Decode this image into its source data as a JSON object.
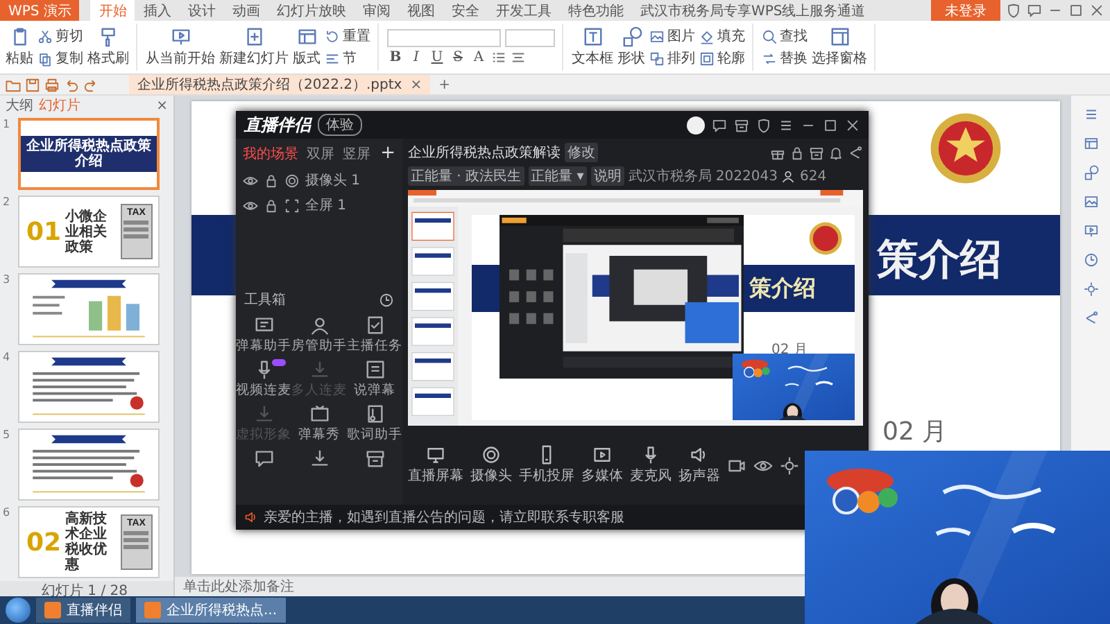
{
  "app_menu": {
    "label": "WPS 演示"
  },
  "tabs": [
    {
      "label": "开始",
      "selected": true
    },
    {
      "label": "插入",
      "selected": false
    },
    {
      "label": "设计",
      "selected": false
    },
    {
      "label": "动画",
      "selected": false
    },
    {
      "label": "幻灯片放映",
      "selected": false
    },
    {
      "label": "审阅",
      "selected": false
    },
    {
      "label": "视图",
      "selected": false
    },
    {
      "label": "安全",
      "selected": false
    },
    {
      "label": "开发工具",
      "selected": false
    },
    {
      "label": "特色功能",
      "selected": false
    },
    {
      "label": "武汉市税务局专享WPS线上服务通道",
      "selected": false
    }
  ],
  "login_button": "未登录",
  "ribbon": {
    "groups_left": [
      [
        [
          {
            "label": "粘贴",
            "kind": "paste"
          }
        ],
        [
          {
            "label": "剪切",
            "kind": "cut"
          },
          {
            "label": "复制",
            "kind": "copy"
          }
        ],
        [
          {
            "label": "格式刷",
            "kind": "brush"
          }
        ]
      ],
      [
        [
          {
            "label": "从当前开始",
            "kind": "play"
          }
        ],
        [
          {
            "label": "新建幻灯片",
            "kind": "newslide"
          }
        ],
        [
          {
            "label": "版式",
            "kind": "layout"
          }
        ],
        [
          {
            "label": "重置",
            "kind": "reset"
          },
          {
            "label": "节",
            "kind": "section"
          }
        ]
      ]
    ],
    "format_buttons": [
      "B",
      "I",
      "U",
      "S",
      "A"
    ],
    "groups_right": [
      [
        [
          {
            "label": "文本框",
            "kind": "textbox"
          }
        ],
        [
          {
            "label": "形状",
            "kind": "shape"
          }
        ],
        [
          {
            "label": "图片",
            "kind": "picture"
          },
          {
            "label": "排列",
            "kind": "arrange"
          }
        ],
        [
          {
            "label": "填充",
            "kind": "fill"
          },
          {
            "label": "轮廓",
            "kind": "outline"
          }
        ]
      ],
      [
        [
          {
            "label": "查找",
            "kind": "find"
          },
          {
            "label": "替换",
            "kind": "replace"
          }
        ],
        [
          {
            "label": "选择窗格",
            "kind": "pane"
          }
        ]
      ]
    ]
  },
  "document_tab": {
    "title": "企业所得税热点政策介绍（2022.2）.pptx",
    "close": "×",
    "add": "+"
  },
  "slide_panel": {
    "tabs": [
      {
        "label": "大纲",
        "selected": false
      },
      {
        "label": "幻灯片",
        "selected": true
      }
    ],
    "close": "×",
    "thumbnails": [
      {
        "number": "1",
        "selected": true,
        "kind": "title",
        "title": "企业所得税热点政策介绍"
      },
      {
        "number": "2",
        "selected": false,
        "kind": "section",
        "index": "01",
        "title": "小微企业相关政策",
        "doc_label": "TAX"
      },
      {
        "number": "3",
        "selected": false,
        "kind": "chart"
      },
      {
        "number": "4",
        "selected": false,
        "kind": "text"
      },
      {
        "number": "5",
        "selected": false,
        "kind": "text"
      },
      {
        "number": "6",
        "selected": false,
        "kind": "section",
        "index": "02",
        "title": "高新技术企业税收优惠",
        "doc_label": "TAX"
      }
    ],
    "status": "幻灯片 1 / 28"
  },
  "slide": {
    "title_part": "策介绍",
    "date_part": "02 月"
  },
  "notes_placeholder": "单击此处添加备注",
  "live_app": {
    "logo": "直播伴侣",
    "badge": "体验",
    "scene_tabs": [
      {
        "label": "我的场景",
        "selected": true
      },
      {
        "label": "双屏",
        "selected": false
      },
      {
        "label": "竖屏",
        "selected": false
      }
    ],
    "add": "+",
    "sources": [
      {
        "label": "摄像头 1",
        "kind": "camera"
      },
      {
        "label": "全屏 1",
        "kind": "screen"
      }
    ],
    "toolbox_title": "工具箱",
    "tools": [
      {
        "label": "弹幕助手",
        "kind": "danmu",
        "disabled": false,
        "badge": false
      },
      {
        "label": "房管助手",
        "kind": "person",
        "disabled": false,
        "badge": false
      },
      {
        "label": "主播任务",
        "kind": "task",
        "disabled": false,
        "badge": false
      },
      {
        "label": "视频连麦",
        "kind": "mic",
        "disabled": false,
        "badge": true
      },
      {
        "label": "多人连麦",
        "kind": "download",
        "disabled": true,
        "badge": false
      },
      {
        "label": "说弹幕",
        "kind": "talk",
        "disabled": false,
        "badge": false
      },
      {
        "label": "虚拟形象",
        "kind": "download",
        "disabled": true,
        "badge": false
      },
      {
        "label": "弹幕秀",
        "kind": "show",
        "disabled": false,
        "badge": false
      },
      {
        "label": "歌词助手",
        "kind": "lyrics",
        "disabled": false,
        "badge": false
      }
    ],
    "stream_title": "企业所得税热点政策解读",
    "edit": "修改",
    "tags": [
      "正能量 · 政法民生",
      "正能量 ▾",
      "说明"
    ],
    "account": "武汉市税务局 2022043",
    "viewers": "624",
    "preview": {
      "slide_title_part": "策介绍",
      "slide_date_part": "02 月"
    },
    "controls": [
      {
        "label": "直播屏幕",
        "kind": "monitor"
      },
      {
        "label": "摄像头",
        "kind": "camera"
      },
      {
        "label": "手机投屏",
        "kind": "phone"
      },
      {
        "label": "多媒体",
        "kind": "media"
      },
      {
        "label": "麦克风",
        "kind": "mic"
      },
      {
        "label": "扬声器",
        "kind": "speaker"
      }
    ],
    "notice": "亲爱的主播，如遇到直播公告的问题，请立即联系专职客服"
  },
  "taskbar": [
    {
      "label": "直播伴侣",
      "selected": false
    },
    {
      "label": "企业所得税热点...",
      "selected": true
    }
  ]
}
